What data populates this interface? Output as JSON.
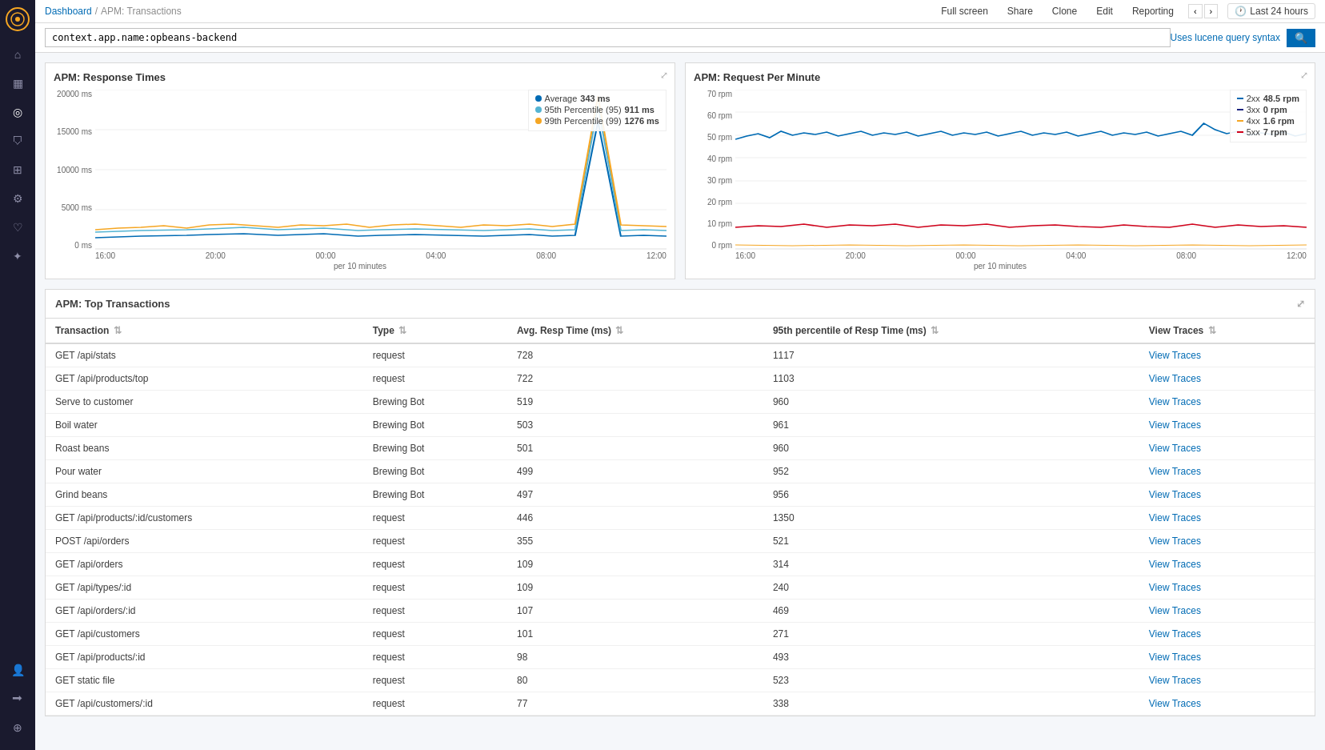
{
  "breadcrumb": {
    "dashboard": "Dashboard",
    "separator": "/",
    "current": "APM: Transactions"
  },
  "topbar": {
    "fullscreen": "Full screen",
    "share": "Share",
    "clone": "Clone",
    "edit": "Edit",
    "reporting": "Reporting",
    "time_label": "Last 24 hours",
    "clock_icon": "🕐"
  },
  "searchbar": {
    "value": "context.app.name:opbeans-backend",
    "hint": "Uses lucene query syntax",
    "search_icon": "🔍"
  },
  "response_times_chart": {
    "title": "APM: Response Times",
    "expand_icon": "⤢",
    "y_labels": [
      "20000 ms",
      "15000 ms",
      "10000 ms",
      "5000 ms",
      "0 ms"
    ],
    "x_labels": [
      "16:00",
      "20:00",
      "00:00",
      "04:00",
      "08:00",
      "12:00"
    ],
    "x_axis_title": "per 10 minutes",
    "legend": [
      {
        "label": "Average",
        "value": "343 ms",
        "color": "#006BB4",
        "type": "line"
      },
      {
        "label": "95th Percentile (95)",
        "value": "911 ms",
        "color": "#54b4d3",
        "type": "line"
      },
      {
        "label": "99th Percentile (99)",
        "value": "1276 ms",
        "color": "#f5a623",
        "type": "line"
      }
    ]
  },
  "request_per_minute_chart": {
    "title": "APM: Request Per Minute",
    "expand_icon": "⤢",
    "y_labels": [
      "70 rpm",
      "60 rpm",
      "50 rpm",
      "40 rpm",
      "30 rpm",
      "20 rpm",
      "10 rpm",
      "0 rpm"
    ],
    "x_labels": [
      "16:00",
      "20:00",
      "00:00",
      "04:00",
      "08:00",
      "12:00"
    ],
    "x_axis_title": "per 10 minutes",
    "legend": [
      {
        "label": "2xx",
        "value": "48.5 rpm",
        "color": "#006BB4",
        "type": "line"
      },
      {
        "label": "3xx",
        "value": "0 rpm",
        "color": "#1a237e",
        "type": "line"
      },
      {
        "label": "4xx",
        "value": "1.6 rpm",
        "color": "#f5a623",
        "type": "line"
      },
      {
        "label": "5xx",
        "value": "7 rpm",
        "color": "#d0021b",
        "type": "line"
      }
    ]
  },
  "transactions_table": {
    "title": "APM: Top Transactions",
    "expand_icon": "⤢",
    "columns": [
      {
        "label": "Transaction",
        "key": "transaction",
        "sortable": true
      },
      {
        "label": "Type",
        "key": "type",
        "sortable": true
      },
      {
        "label": "Avg. Resp Time (ms)",
        "key": "avg_resp",
        "sortable": true
      },
      {
        "label": "95th percentile of Resp Time (ms)",
        "key": "p95_resp",
        "sortable": true
      },
      {
        "label": "View Traces",
        "key": "view_traces",
        "sortable": true
      }
    ],
    "rows": [
      {
        "transaction": "GET /api/stats",
        "type": "request",
        "avg_resp": "728",
        "p95_resp": "1117",
        "view_traces": "View Traces"
      },
      {
        "transaction": "GET /api/products/top",
        "type": "request",
        "avg_resp": "722",
        "p95_resp": "1103",
        "view_traces": "View Traces"
      },
      {
        "transaction": "Serve to customer",
        "type": "Brewing Bot",
        "avg_resp": "519",
        "p95_resp": "960",
        "view_traces": "View Traces"
      },
      {
        "transaction": "Boil water",
        "type": "Brewing Bot",
        "avg_resp": "503",
        "p95_resp": "961",
        "view_traces": "View Traces"
      },
      {
        "transaction": "Roast beans",
        "type": "Brewing Bot",
        "avg_resp": "501",
        "p95_resp": "960",
        "view_traces": "View Traces"
      },
      {
        "transaction": "Pour water",
        "type": "Brewing Bot",
        "avg_resp": "499",
        "p95_resp": "952",
        "view_traces": "View Traces"
      },
      {
        "transaction": "Grind beans",
        "type": "Brewing Bot",
        "avg_resp": "497",
        "p95_resp": "956",
        "view_traces": "View Traces"
      },
      {
        "transaction": "GET /api/products/:id/customers",
        "type": "request",
        "avg_resp": "446",
        "p95_resp": "1350",
        "view_traces": "View Traces"
      },
      {
        "transaction": "POST /api/orders",
        "type": "request",
        "avg_resp": "355",
        "p95_resp": "521",
        "view_traces": "View Traces"
      },
      {
        "transaction": "GET /api/orders",
        "type": "request",
        "avg_resp": "109",
        "p95_resp": "314",
        "view_traces": "View Traces"
      },
      {
        "transaction": "GET /api/types/:id",
        "type": "request",
        "avg_resp": "109",
        "p95_resp": "240",
        "view_traces": "View Traces"
      },
      {
        "transaction": "GET /api/orders/:id",
        "type": "request",
        "avg_resp": "107",
        "p95_resp": "469",
        "view_traces": "View Traces"
      },
      {
        "transaction": "GET /api/customers",
        "type": "request",
        "avg_resp": "101",
        "p95_resp": "271",
        "view_traces": "View Traces"
      },
      {
        "transaction": "GET /api/products/:id",
        "type": "request",
        "avg_resp": "98",
        "p95_resp": "493",
        "view_traces": "View Traces"
      },
      {
        "transaction": "GET static file",
        "type": "request",
        "avg_resp": "80",
        "p95_resp": "523",
        "view_traces": "View Traces"
      },
      {
        "transaction": "GET /api/customers/:id",
        "type": "request",
        "avg_resp": "77",
        "p95_resp": "338",
        "view_traces": "View Traces"
      }
    ]
  },
  "sidebar": {
    "icons": [
      {
        "name": "home",
        "symbol": "⌂",
        "active": false
      },
      {
        "name": "bar-chart",
        "symbol": "▦",
        "active": false
      },
      {
        "name": "compass",
        "symbol": "◎",
        "active": true
      },
      {
        "name": "shield",
        "symbol": "⛉",
        "active": false
      },
      {
        "name": "monitor",
        "symbol": "⊞",
        "active": false
      },
      {
        "name": "tools",
        "symbol": "⚙",
        "active": false
      },
      {
        "name": "heart",
        "symbol": "♡",
        "active": false
      },
      {
        "name": "gear",
        "symbol": "✦",
        "active": false
      },
      {
        "name": "user",
        "symbol": "👤",
        "active": false
      },
      {
        "name": "login",
        "symbol": "⮕",
        "active": false
      },
      {
        "name": "globe",
        "symbol": "⊕",
        "active": false
      }
    ]
  }
}
